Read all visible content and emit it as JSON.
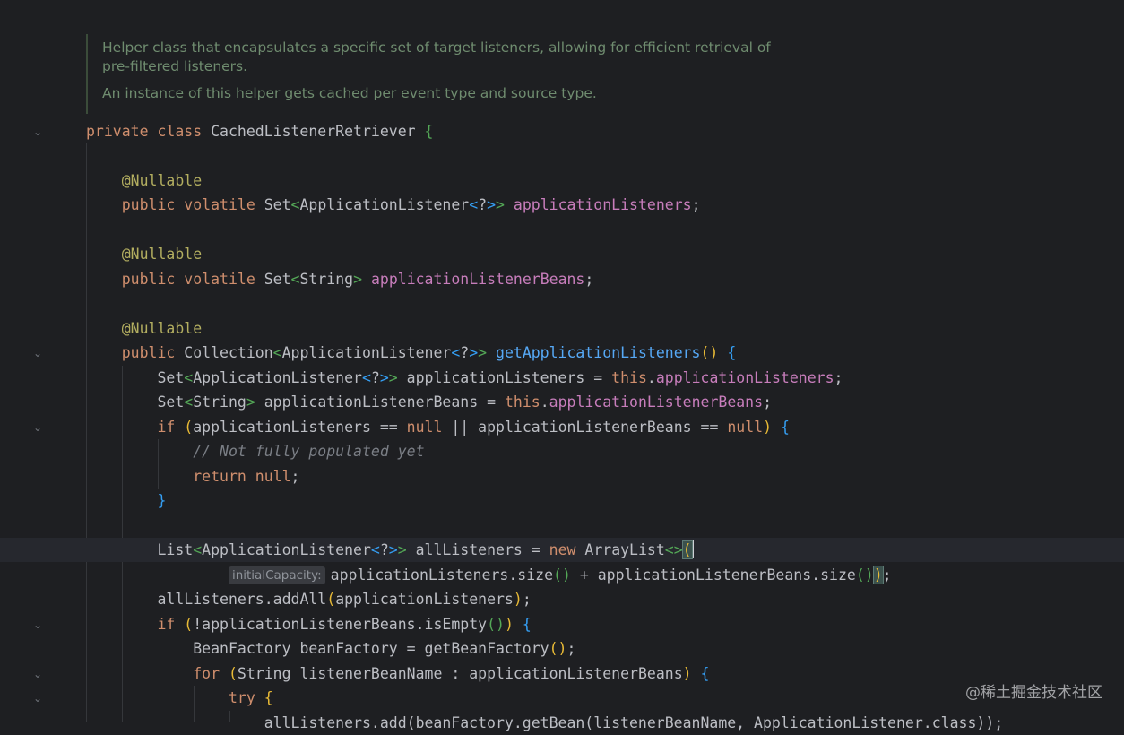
{
  "javadoc": {
    "line1": "Helper class that encapsulates a specific set of target listeners, allowing for efficient retrieval of",
    "line2": "pre-filtered listeners.",
    "line3": "An instance of this helper gets cached per event type and source type."
  },
  "code": {
    "private": "private",
    "class": "class",
    "public": "public",
    "volatile": "volatile",
    "this": "this",
    "if": "if",
    "null": "null",
    "return": "return",
    "new": "new",
    "for": "for",
    "try": "try",
    "annotation_nullable": "@Nullable",
    "class_name": "CachedListenerRetriever",
    "type_set": "Set",
    "type_string": "String",
    "type_collection": "Collection",
    "type_app_listener": "ApplicationListener",
    "type_list": "List",
    "type_arraylist": "ArrayList",
    "type_beanfactory": "BeanFactory",
    "field_app_listeners": "applicationListeners",
    "field_app_listener_beans": "applicationListenerBeans",
    "method_get_app_listeners": "getApplicationListeners",
    "var_app_listeners": "applicationListeners",
    "var_app_listener_beans": "applicationListenerBeans",
    "var_all_listeners": "allListeners",
    "var_bean_factory": "beanFactory",
    "var_listener_bean_name": "listenerBeanName",
    "wildcard": "?",
    "comment_not_populated": "// Not fully populated yet",
    "size_call": "size",
    "addall_call": "addAll",
    "isempty_call": "isEmpty",
    "getbeanfactory_call": "getBeanFactory",
    "partial_last_line": "allListeners.add(beanFactory.getBean(listenerBeanName, ApplicationListener.class));",
    "inlay_hint_initial_capacity": "initialCapacity:"
  },
  "watermark": "@稀土掘金技术社区",
  "icons": [
    "fold-chevron-icon"
  ]
}
